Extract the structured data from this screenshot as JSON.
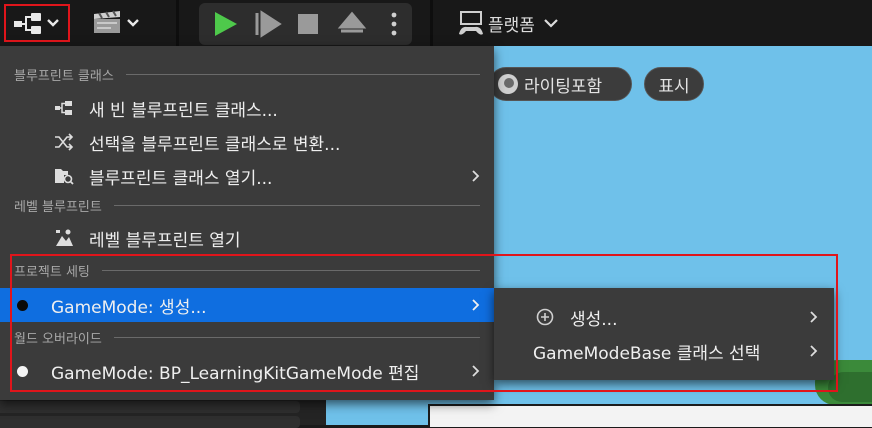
{
  "toolbar": {
    "platform_label": "플랫폼"
  },
  "viewport": {
    "lighting_label": "라이팅포함",
    "show_label": "표시"
  },
  "menu": {
    "section_blueprint_class": "블루프린트 클래스",
    "new_blueprint_class": "새 빈 블루프린트 클래스...",
    "convert_to_blueprint": "선택을 블루프린트 클래스로 변환...",
    "open_blueprint_class": "블루프린트 클래스 열기...",
    "section_level_blueprint": "레벨 블루프린트",
    "open_level_blueprint": "레벨 블루프린트 열기",
    "section_project_settings": "프로젝트 세팅",
    "gamemode_create": "GameMode: 생성...",
    "section_world_override": "월드 오버라이드",
    "gamemode_edit": "GameMode: BP_LearningKitGameMode 편집"
  },
  "submenu": {
    "create": "생성...",
    "select_base_class": "GameModeBase 클래스 선택"
  },
  "colors": {
    "highlight": "#0f6ee0",
    "annotation_red": "#e0151b",
    "play_green": "#4ec94b",
    "menu_bg": "#3b3b3b"
  }
}
